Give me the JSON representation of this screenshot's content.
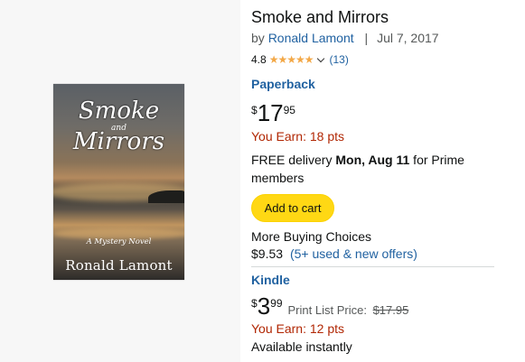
{
  "book": {
    "title": "Smoke and Mirrors",
    "by_prefix": "by",
    "author": "Ronald Lamont",
    "separator": "|",
    "date": "Jul 7, 2017",
    "rating": "4.8",
    "stars": "★★★★★",
    "review_count": "(13)"
  },
  "cover": {
    "title_line1": "Smoke",
    "title_and": "and",
    "title_line2": "Mirrors",
    "tagline": "A Mystery Novel",
    "author": "Ronald Lamont"
  },
  "paperback": {
    "format": "Paperback",
    "currency": "$",
    "price_whole": "17",
    "price_fraction": "95",
    "earn": "You Earn: 18 pts",
    "delivery_prefix": "FREE delivery ",
    "delivery_date": "Mon, Aug 11",
    "delivery_suffix": " for Prime members",
    "add_to_cart": "Add to cart",
    "more_choices": "More Buying Choices",
    "used_price": "$9.53",
    "used_offers": "(5+ used & new offers)"
  },
  "kindle": {
    "format": "Kindle",
    "currency": "$",
    "price_whole": "3",
    "price_fraction": "99",
    "print_list_label": "Print List Price:",
    "print_list_price": "$17.95",
    "earn": "You Earn: 12 pts",
    "availability": "Available instantly"
  },
  "colors": {
    "link": "#2162a1",
    "earn": "#b12704",
    "cart_button": "#ffd814",
    "stars": "#f3a847"
  }
}
